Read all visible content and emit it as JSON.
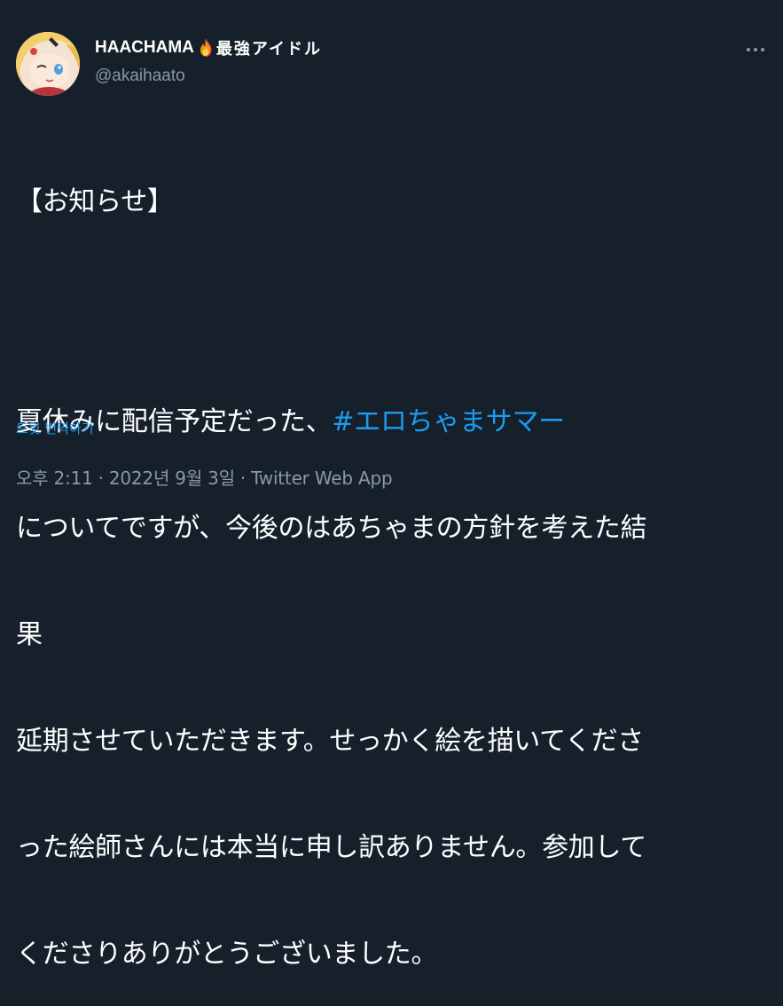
{
  "author": {
    "display_name": "HAACHAMA",
    "display_suffix": "最強アイドル",
    "handle": "@akaihaato",
    "emoji_icon": "fire-emoji"
  },
  "tweet": {
    "line1": "【お知らせ】",
    "line2_text": "夏休みに配信予定だった、",
    "hashtag": "#エロちゃまサマー",
    "line3": "についてですが、今後のはあちゃまの方針を考えた結",
    "line4": "果",
    "line5": "延期させていただきます。せっかく絵を描いてくださ",
    "line6": "った絵師さんには本当に申し訳ありません。参加して",
    "line7": "くださりありがとうございました。"
  },
  "translate_label": "트윗 번역하기",
  "meta": {
    "time": "오후 2:11",
    "separator": "·",
    "date": "2022년 9월 3일",
    "source": "Twitter Web App"
  },
  "colors": {
    "background": "#15202b",
    "text": "#ffffff",
    "secondary": "#8b98a5",
    "accent": "#1d9bf0"
  }
}
